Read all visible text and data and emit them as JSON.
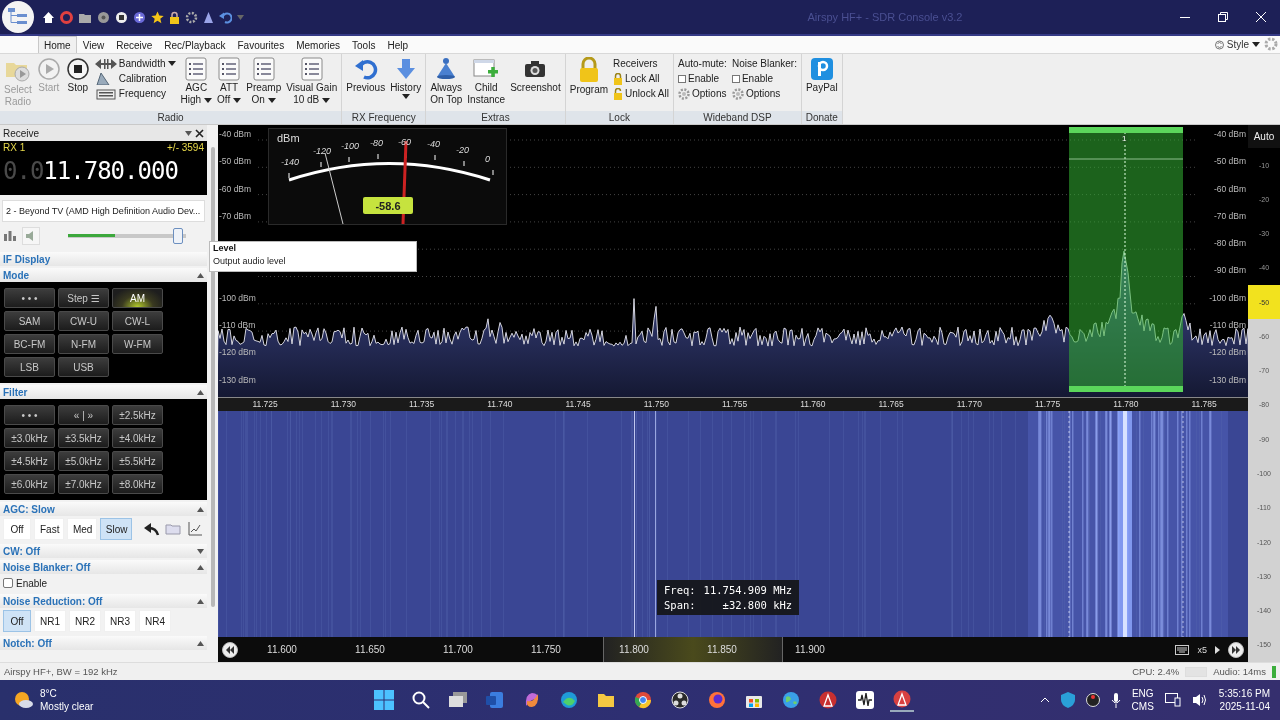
{
  "window": {
    "title": "Airspy HF+ - SDR Console v3.2"
  },
  "menu_tabs": [
    {
      "label": "Home",
      "selected": true
    },
    {
      "label": "View",
      "selected": false
    },
    {
      "label": "Receive",
      "selected": false
    },
    {
      "label": "Rec/Playback",
      "selected": false
    },
    {
      "label": "Favourites",
      "selected": false
    },
    {
      "label": "Memories",
      "selected": false
    },
    {
      "label": "Tools",
      "selected": false
    },
    {
      "label": "Help",
      "selected": false
    }
  ],
  "style_menu": "Style",
  "ribbon": [
    {
      "title": "Radio",
      "items": [
        {
          "kind": "large",
          "lines": [
            "Select",
            "Radio"
          ],
          "disabled": true,
          "dropdown": false
        },
        {
          "kind": "large",
          "lines": [
            "Start"
          ],
          "disabled": true,
          "dropdown": false
        },
        {
          "kind": "large",
          "lines": [
            "Stop"
          ],
          "disabled": false,
          "dropdown": false
        },
        {
          "kind": "stack",
          "rows": [
            {
              "kind": "item",
              "label": "Bandwidth",
              "dropdown": true
            },
            {
              "kind": "item",
              "label": "Calibration",
              "dropdown": false
            },
            {
              "kind": "item",
              "label": "Frequency",
              "dropdown": false
            }
          ]
        },
        {
          "kind": "large",
          "lines": [
            "AGC",
            "High"
          ],
          "disabled": false,
          "dropdown": true
        },
        {
          "kind": "large",
          "lines": [
            "ATT",
            "Off"
          ],
          "disabled": false,
          "dropdown": true
        },
        {
          "kind": "large",
          "lines": [
            "Preamp",
            "On"
          ],
          "disabled": false,
          "dropdown": true
        },
        {
          "kind": "large",
          "lines": [
            "Visual Gain",
            "10 dB"
          ],
          "disabled": false,
          "dropdown": true
        }
      ]
    },
    {
      "title": "RX Frequency",
      "items": [
        {
          "kind": "large",
          "lines": [
            "Previous"
          ],
          "disabled": false,
          "dropdown": false
        },
        {
          "kind": "large",
          "lines": [
            "History"
          ],
          "disabled": false,
          "dropdown": true
        }
      ]
    },
    {
      "title": "Extras",
      "items": [
        {
          "kind": "large",
          "lines": [
            "Always",
            "On Top"
          ],
          "disabled": false,
          "dropdown": false
        },
        {
          "kind": "large",
          "lines": [
            "Child",
            "Instance"
          ],
          "disabled": false,
          "dropdown": false
        },
        {
          "kind": "large",
          "lines": [
            "Screenshot"
          ],
          "disabled": false,
          "dropdown": false
        }
      ]
    },
    {
      "title": "Lock",
      "items": [
        {
          "kind": "large",
          "lines": [
            "Program"
          ],
          "disabled": false,
          "dropdown": false
        },
        {
          "kind": "stack",
          "rows": [
            {
              "kind": "heading",
              "label": "Receivers"
            },
            {
              "kind": "item",
              "label": "Lock All",
              "dropdown": false
            },
            {
              "kind": "item",
              "label": "Unlock All",
              "dropdown": false
            }
          ]
        }
      ]
    },
    {
      "title": "Wideband DSP",
      "items": [
        {
          "kind": "stack",
          "rows": [
            {
              "kind": "heading",
              "label": "Auto-mute:"
            },
            {
              "kind": "check",
              "label": "Enable",
              "checked": false
            },
            {
              "kind": "item",
              "label": "Options",
              "dropdown": false
            }
          ]
        },
        {
          "kind": "stack",
          "rows": [
            {
              "kind": "heading",
              "label": "Noise Blanker:"
            },
            {
              "kind": "check",
              "label": "Enable",
              "checked": false
            },
            {
              "kind": "item",
              "label": "Options",
              "dropdown": false
            }
          ]
        }
      ]
    },
    {
      "title": "Donate",
      "items": [
        {
          "kind": "large",
          "lines": [
            "PayPal"
          ],
          "disabled": false,
          "dropdown": false
        }
      ]
    }
  ],
  "left_panel": {
    "title": "Receive",
    "rx": {
      "name": "RX 1",
      "offset": "+/- 3594",
      "frequency_dim": "0.0",
      "frequency": "11.780.000"
    },
    "audio_device": "2 - Beyond TV (AMD High Definition Audio Dev...",
    "volume": {
      "level": 0.93
    },
    "output_meter": {
      "level": 0.4
    },
    "sections": [
      {
        "title": "IF Display"
      },
      {
        "title": "Mode",
        "expanded": true,
        "kind": "grid",
        "buttons": [
          {
            "label": "• • •",
            "selected": false
          },
          {
            "label": "Step ☰",
            "selected": false
          },
          {
            "label": "AM",
            "selected": true
          },
          {
            "label": "SAM",
            "selected": false
          },
          {
            "label": "CW-U",
            "selected": false
          },
          {
            "label": "CW-L",
            "selected": false
          },
          {
            "label": "BC-FM",
            "selected": false
          },
          {
            "label": "N-FM",
            "selected": false
          },
          {
            "label": "W-FM",
            "selected": false
          },
          {
            "label": "LSB",
            "selected": false
          },
          {
            "label": "USB",
            "selected": false
          }
        ]
      },
      {
        "title": "Filter",
        "expanded": true,
        "kind": "grid",
        "buttons": [
          {
            "label": "• • •",
            "selected": false
          },
          {
            "label": "« | »",
            "selected": false
          },
          {
            "label": "±2.5kHz",
            "selected": false
          },
          {
            "label": "±3.0kHz",
            "selected": false
          },
          {
            "label": "±3.5kHz",
            "selected": false
          },
          {
            "label": "±4.0kHz",
            "selected": false
          },
          {
            "label": "±4.5kHz",
            "selected": false
          },
          {
            "label": "±5.0kHz",
            "selected": false
          },
          {
            "label": "±5.5kHz",
            "selected": false
          },
          {
            "label": "±6.0kHz",
            "selected": false
          },
          {
            "label": "±7.0kHz",
            "selected": false
          },
          {
            "label": "±8.0kHz",
            "selected": false
          }
        ]
      },
      {
        "title": "AGC: Slow",
        "expanded": true,
        "kind": "tool_toggles",
        "buttons": [
          {
            "label": "Off",
            "selected": false
          },
          {
            "label": "Fast",
            "selected": false
          },
          {
            "label": "Med",
            "selected": false
          },
          {
            "label": "Slow",
            "selected": true
          }
        ]
      },
      {
        "title": "CW: Off",
        "expanded": false
      },
      {
        "title": "Noise Blanker: Off",
        "expanded": true,
        "kind": "check",
        "check": {
          "label": "Enable",
          "checked": false
        }
      },
      {
        "title": "Noise Reduction: Off",
        "expanded": true,
        "kind": "toggles",
        "buttons": [
          {
            "label": "Off",
            "selected": true
          },
          {
            "label": "NR1",
            "selected": false
          },
          {
            "label": "NR2",
            "selected": false
          },
          {
            "label": "NR3",
            "selected": false
          },
          {
            "label": "NR4",
            "selected": false
          }
        ]
      },
      {
        "title": "Notch: Off",
        "expanded": true
      }
    ]
  },
  "tooltip": {
    "title": "Level",
    "text": "Output audio level"
  },
  "meter": {
    "unit": "dBm",
    "scale": [
      "-140",
      "-120",
      "-100",
      "-80",
      "-60",
      "-40",
      "-20",
      "0"
    ],
    "reading": "-58.6"
  },
  "spectrum": {
    "y_labels_left_upper": [
      "-40 dBm",
      "-50 dBm",
      "-60 dBm",
      "-70 dBm"
    ],
    "y_labels_left_lower": [
      "-100 dBm",
      "-110 dBm",
      "-120 dBm",
      "-130 dBm"
    ],
    "y_labels_right": [
      "-40 dBm",
      "-50 dBm",
      "-60 dBm",
      "-70 dBm",
      "-80 dBm",
      "-90 dBm",
      "-100 dBm",
      "-110 dBm",
      "-120 dBm",
      "-130 dBm"
    ],
    "x_labels": [
      "11.725",
      "11.730",
      "11.735",
      "11.740",
      "11.745",
      "11.750",
      "11.755",
      "11.760",
      "11.765",
      "11.770",
      "11.775",
      "11.780",
      "11.785"
    ],
    "receiver_label": "1"
  },
  "waterfall_scale": {
    "mode": "Auto",
    "marks": [
      {
        "label": "-10",
        "selected": false
      },
      {
        "label": "-20",
        "selected": false
      },
      {
        "label": "-30",
        "selected": false
      },
      {
        "label": "-40",
        "selected": false
      },
      {
        "label": "-50",
        "selected": true
      },
      {
        "label": "-60",
        "selected": false
      },
      {
        "label": "-70",
        "selected": false
      },
      {
        "label": "-80",
        "selected": false
      },
      {
        "label": "-90",
        "selected": false
      },
      {
        "label": "-100",
        "selected": false
      },
      {
        "label": "-110",
        "selected": false
      },
      {
        "label": "-120",
        "selected": false
      },
      {
        "label": "-130",
        "selected": false
      },
      {
        "label": "-140",
        "selected": false
      },
      {
        "label": "-150",
        "selected": false
      }
    ]
  },
  "cursor_info": {
    "freq_label": "Freq:",
    "freq": "11.754.909 MHz",
    "span_label": "Span:",
    "span": "±32.800 kHz"
  },
  "overview": {
    "labels": [
      "11.600",
      "11.650",
      "11.700",
      "11.750",
      "11.800",
      "11.850",
      "11.900"
    ],
    "zoom": "x5"
  },
  "status_bar": {
    "device": "Airspy HF+, BW = 192 kHz",
    "cpu": "CPU: 2.4%",
    "audio": "Audio: 14ms"
  },
  "taskbar": {
    "temperature": "8°C",
    "weather": "Mostly clear",
    "language": "ENG",
    "layout": "CMS",
    "time": "5:35:16 PM",
    "date": "2025-11-04"
  }
}
